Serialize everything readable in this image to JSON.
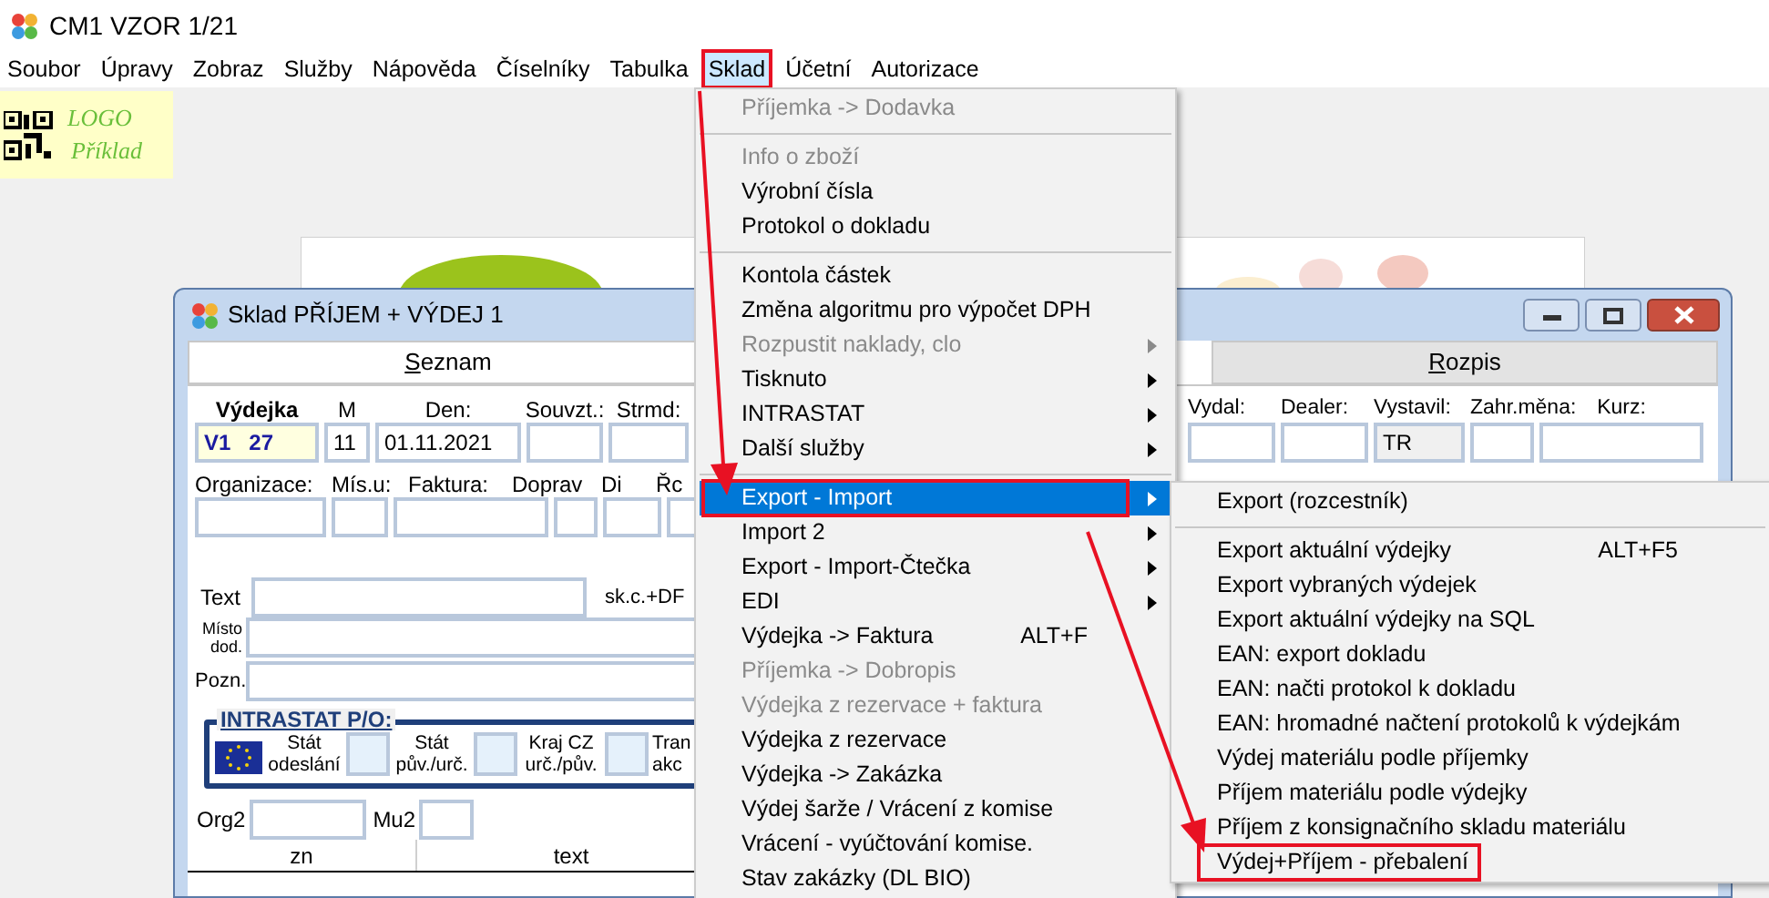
{
  "app_window": {
    "title": "CM1 VZOR 1/21"
  },
  "menu_bar": [
    {
      "label": "Soubor",
      "selected": false,
      "highlighted": false
    },
    {
      "label": "Úpravy",
      "selected": false,
      "highlighted": false
    },
    {
      "label": "Zobraz",
      "selected": false,
      "highlighted": false
    },
    {
      "label": "Služby",
      "selected": false,
      "highlighted": false
    },
    {
      "label": "Nápověda",
      "selected": false,
      "highlighted": false
    },
    {
      "label": "Číselníky",
      "selected": false,
      "highlighted": false
    },
    {
      "label": "Tabulka",
      "selected": false,
      "highlighted": false
    },
    {
      "label": "Sklad",
      "selected": true,
      "highlighted": true
    },
    {
      "label": "Účetní",
      "selected": false,
      "highlighted": false
    },
    {
      "label": "Autorizace",
      "selected": false,
      "highlighted": false
    }
  ],
  "logo": {
    "lines": [
      "LOGO",
      "Příklad"
    ]
  },
  "document_window": {
    "title": "Sklad PŘÍJEM + VÝDEJ 1",
    "tabs": [
      {
        "label": "Seznam",
        "selected": true
      },
      {
        "label": "Rozpis",
        "selected": false
      }
    ],
    "header_fields_left": [
      {
        "label": "Výdejka",
        "value": "V1 27",
        "kind": "document"
      },
      {
        "label": "M",
        "value": "11",
        "kind": "plain"
      },
      {
        "label": "Den:",
        "value": "01.11.2021",
        "kind": "plain"
      },
      {
        "label": "Souvzt.:",
        "kind": "plain"
      },
      {
        "label": "Strmd:",
        "kind": "plain"
      }
    ],
    "header_fields_right": [
      {
        "label": "Vydal:",
        "kind": "plain"
      },
      {
        "label": "Dealer:",
        "kind": "plain"
      },
      {
        "label": "Vystavil:",
        "value": "TR",
        "kind": "readonly"
      },
      {
        "label": "Zahr.měna:",
        "kind": "plain"
      },
      {
        "label": "Kurz:",
        "kind": "plain"
      }
    ],
    "row2_labels": [
      "Organizace:",
      "Mís.u:",
      "Faktura:",
      "Doprav",
      "Di",
      "Řc"
    ],
    "text_label": "Text",
    "text_side_label": "sk.c.+DF",
    "place_label": "Místo dod.",
    "note_label": "Pozn.",
    "intrastat": {
      "title": "INTRASTAT P/O:",
      "labels": [
        "Stát odeslání",
        "Stát pův./urč.",
        "Kraj CZ urč./pův.",
        "Tran akc"
      ]
    },
    "org2_label": "Org2",
    "mu2_label": "Mu2",
    "table": {
      "columns": [
        "zn",
        "text"
      ]
    }
  },
  "sklad_menu": {
    "items": [
      {
        "kind": "item",
        "label": "Příjemka -> Dodavka",
        "disabled": true,
        "submenu": false,
        "selected": false,
        "highlighted": false
      },
      {
        "kind": "separator"
      },
      {
        "kind": "item",
        "label": "Info o zboží",
        "disabled": true,
        "submenu": false,
        "selected": false,
        "highlighted": false
      },
      {
        "kind": "item",
        "label": "Výrobní čísla",
        "disabled": false,
        "submenu": false,
        "selected": false,
        "highlighted": false
      },
      {
        "kind": "item",
        "label": "Protokol o dokladu",
        "disabled": false,
        "submenu": false,
        "selected": false,
        "highlighted": false
      },
      {
        "kind": "separator"
      },
      {
        "kind": "item",
        "label": "Kontola částek",
        "disabled": false,
        "submenu": false,
        "selected": false,
        "highlighted": false
      },
      {
        "kind": "item",
        "label": "Změna algoritmu pro výpočet DPH",
        "disabled": false,
        "submenu": false,
        "selected": false,
        "highlighted": false
      },
      {
        "kind": "item",
        "label": "Rozpustit naklady, clo",
        "disabled": true,
        "submenu": true,
        "selected": false,
        "highlighted": false
      },
      {
        "kind": "item",
        "label": "Tisknuto",
        "disabled": false,
        "submenu": true,
        "selected": false,
        "highlighted": false
      },
      {
        "kind": "item",
        "label": "INTRASTAT",
        "disabled": false,
        "submenu": true,
        "selected": false,
        "highlighted": false
      },
      {
        "kind": "item",
        "label": "Další služby",
        "disabled": false,
        "submenu": true,
        "selected": false,
        "highlighted": false
      },
      {
        "kind": "separator"
      },
      {
        "kind": "item",
        "label": "Export - Import",
        "disabled": false,
        "submenu": true,
        "selected": true,
        "highlighted": true
      },
      {
        "kind": "item",
        "label": "Import 2",
        "disabled": false,
        "submenu": true,
        "selected": false,
        "highlighted": false
      },
      {
        "kind": "item",
        "label": "Export - Import-Čtečka",
        "disabled": false,
        "submenu": true,
        "selected": false,
        "highlighted": false
      },
      {
        "kind": "item",
        "label": "EDI",
        "disabled": false,
        "submenu": true,
        "selected": false,
        "highlighted": false
      },
      {
        "kind": "item",
        "label": "Výdejka -> Faktura",
        "shortcut": "ALT+F",
        "disabled": false,
        "submenu": false,
        "selected": false,
        "highlighted": false
      },
      {
        "kind": "item",
        "label": "Příjemka -> Dobropis",
        "disabled": true,
        "submenu": false,
        "selected": false,
        "highlighted": false
      },
      {
        "kind": "item",
        "label": "Výdejka z rezervace + faktura",
        "disabled": true,
        "submenu": false,
        "selected": false,
        "highlighted": false
      },
      {
        "kind": "item",
        "label": "Výdejka z rezervace",
        "disabled": false,
        "submenu": false,
        "selected": false,
        "highlighted": false
      },
      {
        "kind": "item",
        "label": "Výdejka -> Zakázka",
        "disabled": false,
        "submenu": false,
        "selected": false,
        "highlighted": false
      },
      {
        "kind": "item",
        "label": "Výdej šarže / Vrácení z komise",
        "disabled": false,
        "submenu": false,
        "selected": false,
        "highlighted": false
      },
      {
        "kind": "item",
        "label": "Vrácení - vyúčtování komise.",
        "disabled": false,
        "submenu": false,
        "selected": false,
        "highlighted": false
      },
      {
        "kind": "item",
        "label": "Stav zakázky (DL BIO)",
        "disabled": false,
        "submenu": false,
        "selected": false,
        "highlighted": false
      }
    ]
  },
  "export_import_submenu": {
    "items": [
      {
        "kind": "item",
        "label": "Export (rozcestník)",
        "disabled": false,
        "submenu": false,
        "selected": false,
        "highlighted": false
      },
      {
        "kind": "separator"
      },
      {
        "kind": "item",
        "label": "Export aktuální výdejky",
        "shortcut": "ALT+F5",
        "disabled": false,
        "submenu": false,
        "selected": false,
        "highlighted": false
      },
      {
        "kind": "item",
        "label": "Export vybraných výdejek",
        "disabled": false,
        "submenu": false,
        "selected": false,
        "highlighted": false
      },
      {
        "kind": "item",
        "label": "Export aktuální výdejky na SQL",
        "disabled": false,
        "submenu": false,
        "selected": false,
        "highlighted": false
      },
      {
        "kind": "item",
        "label": "EAN: export dokladu",
        "disabled": false,
        "submenu": false,
        "selected": false,
        "highlighted": false
      },
      {
        "kind": "item",
        "label": "EAN: načti protokol k dokladu",
        "disabled": false,
        "submenu": false,
        "selected": false,
        "highlighted": false
      },
      {
        "kind": "item",
        "label": "EAN: hromadné načtení protokolů k výdejkám",
        "disabled": false,
        "submenu": false,
        "selected": false,
        "highlighted": false
      },
      {
        "kind": "item",
        "label": "Výdej materiálu podle příjemky",
        "disabled": false,
        "submenu": false,
        "selected": false,
        "highlighted": false
      },
      {
        "kind": "item",
        "label": "Příjem materiálu podle výdejky",
        "disabled": false,
        "submenu": false,
        "selected": false,
        "highlighted": false
      },
      {
        "kind": "item",
        "label": "Příjem z konsignačního skladu materiálu",
        "disabled": false,
        "submenu": false,
        "selected": false,
        "highlighted": false
      },
      {
        "kind": "item",
        "label": "Výdej+Příjem - přebalení",
        "disabled": false,
        "submenu": false,
        "selected": false,
        "highlighted": true
      }
    ]
  }
}
